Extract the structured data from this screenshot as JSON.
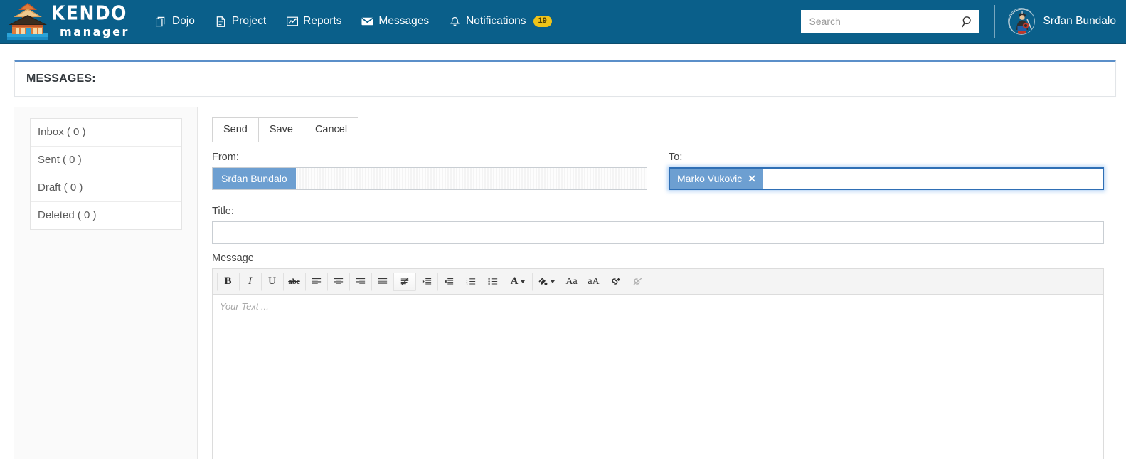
{
  "navbar": {
    "brand": {
      "kendo": "KENDO",
      "manager": "manager",
      "logo_icon": "pagoda-temple-logo"
    },
    "items": [
      {
        "label": "Dojo",
        "icon": "copy-icon"
      },
      {
        "label": "Project",
        "icon": "document-icon"
      },
      {
        "label": "Reports",
        "icon": "chart-line-icon"
      },
      {
        "label": "Messages",
        "icon": "envelope-icon"
      },
      {
        "label": "Notifications",
        "icon": "bell-icon",
        "badge": "19"
      }
    ],
    "search": {
      "placeholder": "Search",
      "value": "",
      "icon": "search-icon"
    },
    "user": {
      "name": "Srđan Bundalo",
      "avatar_icon": "kendo-warrior-avatar"
    }
  },
  "panel": {
    "title": "MESSAGES:"
  },
  "sidebar": {
    "items": [
      {
        "label": "Inbox ( 0 )"
      },
      {
        "label": "Sent ( 0 )"
      },
      {
        "label": "Draft ( 0 )"
      },
      {
        "label": "Deleted ( 0 )"
      }
    ]
  },
  "compose": {
    "buttons": {
      "send": "Send",
      "save": "Save",
      "cancel": "Cancel"
    },
    "from": {
      "label": "From:",
      "token": "Srđan Bundalo"
    },
    "to": {
      "label": "To:",
      "token": "Marko Vukovic",
      "remove": "✕"
    },
    "title": {
      "label": "Title:",
      "value": "",
      "placeholder": ""
    },
    "message": {
      "label": "Message",
      "placeholder": "Your Text ..."
    },
    "toolbar": [
      {
        "name": "bold",
        "glyph": "B"
      },
      {
        "name": "italic",
        "glyph": "I"
      },
      {
        "name": "underline",
        "glyph": "U"
      },
      {
        "name": "strikethrough",
        "glyph": "abc"
      },
      {
        "name": "align-left",
        "glyph": ""
      },
      {
        "name": "align-center",
        "glyph": ""
      },
      {
        "name": "align-right",
        "glyph": ""
      },
      {
        "name": "align-justify",
        "glyph": ""
      },
      {
        "name": "remove-format",
        "glyph": ""
      },
      {
        "name": "indent",
        "glyph": ""
      },
      {
        "name": "outdent",
        "glyph": ""
      },
      {
        "name": "ordered-list",
        "glyph": ""
      },
      {
        "name": "unordered-list",
        "glyph": ""
      },
      {
        "name": "font-color",
        "glyph": "A"
      },
      {
        "name": "background-color",
        "glyph": ""
      },
      {
        "name": "font-size-up",
        "glyph": "Aa"
      },
      {
        "name": "font-size-down",
        "glyph": "aA"
      },
      {
        "name": "insert-link",
        "glyph": ""
      },
      {
        "name": "unlink",
        "glyph": ""
      }
    ]
  },
  "colors": {
    "navbar_blue": "#0a5f8a",
    "panel_accent": "#5b8fc9",
    "token_blue": "#6d9fd1",
    "badge_yellow": "#f0c419",
    "focus_blue": "#2f6fb5"
  }
}
